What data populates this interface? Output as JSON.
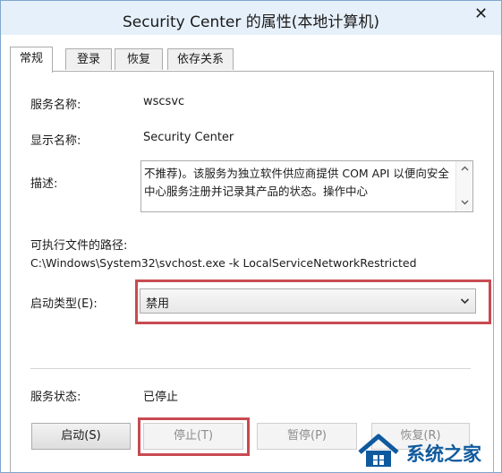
{
  "window": {
    "title": "Security Center 的属性(本地计算机)",
    "close_symbol": "✕"
  },
  "tabs": [
    {
      "label": "常规",
      "active": true
    },
    {
      "label": "登录",
      "active": false
    },
    {
      "label": "恢复",
      "active": false
    },
    {
      "label": "依存关系",
      "active": false
    }
  ],
  "general": {
    "service_name_label": "服务名称:",
    "service_name_value": "wscsvc",
    "display_name_label": "显示名称:",
    "display_name_value": "Security Center",
    "description_label": "描述:",
    "description_text": "不推荐)。该服务为独立软件供应商提供 COM API 以便向安全中心服务注册并记录其产品的状态。操作中心",
    "exe_path_label": "可执行文件的路径:",
    "exe_path_value": "C:\\Windows\\System32\\svchost.exe -k LocalServiceNetworkRestricted",
    "startup_type_label": "启动类型(E):",
    "startup_type_value": "禁用",
    "service_status_label": "服务状态:",
    "service_status_value": "已停止"
  },
  "buttons": {
    "start": "启动(S)",
    "stop": "停止(T)",
    "pause": "暂停(P)",
    "resume": "恢复(R)"
  },
  "watermark": {
    "text": "系统之家",
    "brand_color": "#0f5a9e"
  },
  "colors": {
    "highlight": "#c84a52",
    "titlebar": "#e6f0fa"
  },
  "icons": {
    "close": "close-icon",
    "scroll_up": "chevron-up-icon",
    "scroll_down": "chevron-down-icon",
    "dropdown": "chevron-down-icon",
    "watermark_logo": "house-logo-icon"
  }
}
